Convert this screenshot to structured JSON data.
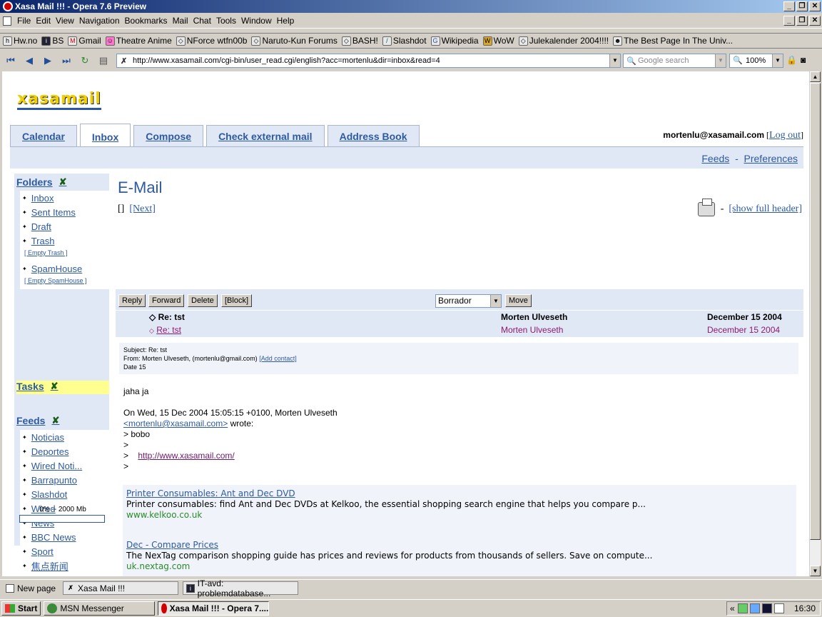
{
  "window": {
    "title": "Xasa Mail !!! - Opera 7.6 Preview"
  },
  "menubar": [
    "File",
    "Edit",
    "View",
    "Navigation",
    "Bookmarks",
    "Mail",
    "Chat",
    "Tools",
    "Window",
    "Help"
  ],
  "bookmarks": [
    "Hw.no",
    "BS",
    "Gmail",
    "Theatre Anime",
    "NForce wtfn00b",
    "Naruto-Kun Forums",
    "BASH!",
    "Slashdot",
    "Wikipedia",
    "WoW",
    "Julekalender 2004!!!!",
    "The Best Page In The Univ..."
  ],
  "address": {
    "url": "http://www.xasamail.com/cgi-bin/user_read.cgi/english?acc=mortenlu&dir=inbox&read=4",
    "search_placeholder": "Google search",
    "zoom": "100%"
  },
  "site": {
    "logo": "xasamail",
    "tabs": [
      "Calendar",
      "Inbox",
      "Compose",
      "Check external mail",
      "Address Book"
    ],
    "active_tab": "Inbox",
    "user_email": "mortenlu@xasamail.com",
    "logout": "Log out",
    "feeds_link": "Feeds",
    "sep": "-",
    "preferences_link": "Preferences"
  },
  "sidebar": {
    "folders_title": "Folders",
    "folders": [
      {
        "label": "Inbox"
      },
      {
        "label": "Sent Items"
      },
      {
        "label": "Draft"
      },
      {
        "label": "Trash",
        "sub": "[ Empty Trash ]"
      },
      {
        "label": "SpamHouse",
        "sub": "[ Empty SpamHouse ]"
      }
    ],
    "tasks_title": "Tasks",
    "feeds_title": "Feeds",
    "feeds": [
      "Noticias",
      "Deportes",
      "Wired Noti...",
      "Barrapunto",
      "Slashdot",
      "Wired",
      "News",
      "BBC News",
      "Sport",
      "焦点新闻"
    ],
    "quota": "0% -- 2000 Mb",
    "quota_percent": 0
  },
  "message": {
    "page_title": "E-Mail",
    "prev": "[]",
    "next": "[Next]",
    "show_header": "[show full header]",
    "buttons": {
      "reply": "Reply",
      "forward": "Forward",
      "delete": "Delete",
      "block": "[Block]",
      "move": "Move"
    },
    "folder_select": "Borrador",
    "thread": [
      {
        "subject": "Re: tst",
        "from": "Morten Ulveseth",
        "date": "December 15 2004"
      },
      {
        "subject": "Re: tst",
        "from": "Morten Ulveseth",
        "date": "December 15 2004"
      }
    ],
    "headers": {
      "subject": "Subject: Re: tst",
      "from": "From: Morten Ulveseth, (mortenlu@gmail.com)",
      "add_contact": "[Add contact]",
      "date": "Date  15"
    },
    "body": {
      "line1": "jaha ja",
      "line2": "On Wed, 15 Dec 2004 15:05:15 +0100, Morten Ulveseth",
      "email_link": "<mortenlu@xasamail.com>",
      "wrote": " wrote:",
      "q1": "> bobo",
      "q2": ">",
      "q3": ">    ",
      "q3_link": "http://www.xasamail.com/",
      "q4": ">"
    },
    "ads": [
      {
        "title": "Printer Consumables: Ant and Dec DVD",
        "text": "Printer consumables: find Ant and Dec DVDs at Kelkoo, the essential shopping search engine that helps you compare p...",
        "url": "www.kelkoo.co.uk"
      },
      {
        "title": "Dec - Compare Prices",
        "text": "The NexTag comparison shopping guide has prices and reviews for products from thousands of sellers. Save on compute...",
        "url": "uk.nextag.com"
      }
    ]
  },
  "pagebar": {
    "new_page": "New page",
    "tab1": "Xasa Mail !!!",
    "tab2": "IT-avd: problemdatabase..."
  },
  "taskbar": {
    "start": "Start",
    "task1": "MSN Messenger",
    "task2": "Xasa Mail !!! - Opera 7....",
    "clock": "16:30"
  }
}
